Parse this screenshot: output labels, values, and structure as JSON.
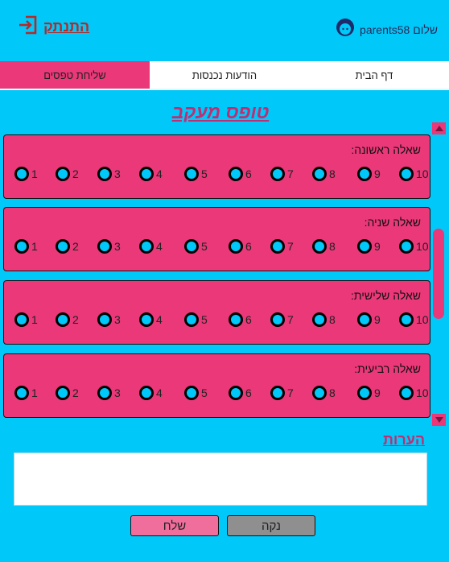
{
  "header": {
    "logout_label": "התנתק",
    "greeting": "שלום parents58"
  },
  "nav": {
    "tabs": [
      {
        "label": "דף הבית",
        "active": false
      },
      {
        "label": "הודעות נכנסות",
        "active": false
      },
      {
        "label": "שליחת טפסים",
        "active": true
      }
    ]
  },
  "form": {
    "title": "טופס מעקב",
    "questions": [
      {
        "label": "שאלה ראשונה:"
      },
      {
        "label": "שאלה שניה:"
      },
      {
        "label": "שאלה שלישית:"
      },
      {
        "label": "שאלה רביעית:"
      }
    ],
    "options": [
      "1",
      "2",
      "3",
      "4",
      "5",
      "6",
      "7",
      "8",
      "9",
      "10"
    ],
    "notes_label": "הערות",
    "notes_value": ""
  },
  "buttons": {
    "send": "שלח",
    "clear": "נקה"
  },
  "colors": {
    "background": "#00c8f8",
    "accent": "#ea3878",
    "title": "#c02e72",
    "logout": "#b22b2b"
  }
}
